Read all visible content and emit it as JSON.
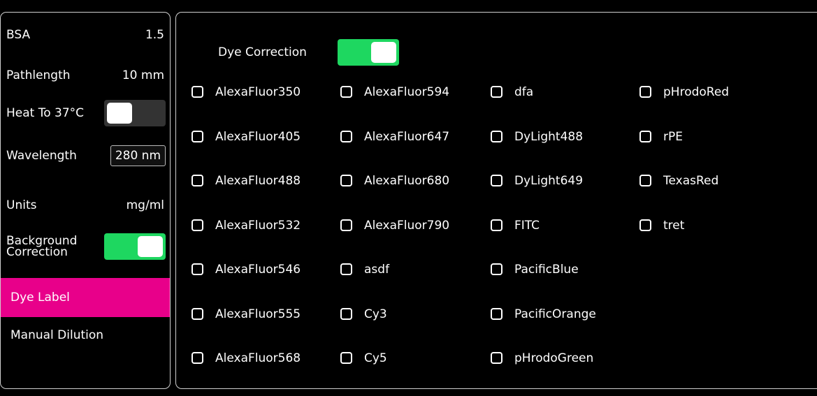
{
  "sidebar": {
    "bsa_label": "BSA",
    "bsa_value": "1.5",
    "pathlength_label": "Pathlength",
    "pathlength_value": "10 mm",
    "heat_label": "Heat To 37°C",
    "wavelength_label": "Wavelength",
    "wavelength_value": "280 nm",
    "units_label": "Units",
    "units_value": "mg/ml",
    "background_label_line1": "Background",
    "background_label_line2": "Correction",
    "dye_label": "Dye Label",
    "manual_dilution": "Manual Dilution"
  },
  "toggles": {
    "heat": "off",
    "background_correction": "on",
    "dye_correction": "on"
  },
  "colors": {
    "accent": "#e8008a",
    "toggle_on": "#1ed760"
  },
  "dye_panel": {
    "dye_correction_label": "Dye Correction",
    "dyes": [
      "AlexaFluor350",
      "AlexaFluor405",
      "AlexaFluor488",
      "AlexaFluor532",
      "AlexaFluor546",
      "AlexaFluor555",
      "AlexaFluor568",
      "AlexaFluor594",
      "AlexaFluor647",
      "AlexaFluor680",
      "AlexaFluor790",
      "asdf",
      "Cy3",
      "Cy5",
      "dfa",
      "DyLight488",
      "DyLight649",
      "FITC",
      "PacificBlue",
      "PacificOrange",
      "pHrodoGreen",
      "pHrodoRed",
      "rPE",
      "TexasRed",
      "tret"
    ]
  }
}
